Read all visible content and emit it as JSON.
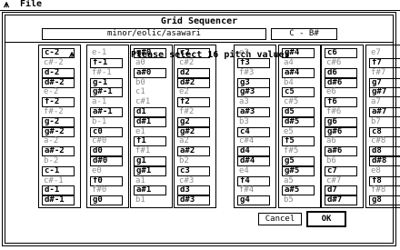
{
  "menubar": {
    "logo": "⩚",
    "file_label": "File"
  },
  "dialog": {
    "title": "Grid Sequencer",
    "scale_field": "minor/eolic/asawari",
    "range_field": "C - B#",
    "note_icon": "⩚",
    "prompt": "Please select 16 pitch values",
    "cancel_label": "Cancel",
    "ok_label": "OK"
  },
  "grid": {
    "columns": [
      {
        "cells": [
          {
            "label": "c-2",
            "selected": true
          },
          {
            "label": "c#-2",
            "selected": false
          },
          {
            "label": "d-2",
            "selected": true
          },
          {
            "label": "d#-2",
            "selected": true
          },
          {
            "label": "e-2",
            "selected": false
          },
          {
            "label": "f-2",
            "selected": true
          },
          {
            "label": "f#-2",
            "selected": false
          },
          {
            "label": "g-2",
            "selected": true
          },
          {
            "label": "g#-2",
            "selected": true
          },
          {
            "label": "a-2",
            "selected": false
          },
          {
            "label": "a#-2",
            "selected": true
          },
          {
            "label": "b-2",
            "selected": false
          },
          {
            "label": "c-1",
            "selected": true
          },
          {
            "label": "c#-1",
            "selected": false
          },
          {
            "label": "d-1",
            "selected": true
          },
          {
            "label": "d#-1",
            "selected": true
          }
        ]
      },
      {
        "cells": [
          {
            "label": "e-1",
            "selected": false
          },
          {
            "label": "f-1",
            "selected": true
          },
          {
            "label": "f#-1",
            "selected": false
          },
          {
            "label": "g-1",
            "selected": true
          },
          {
            "label": "g#-1",
            "selected": true
          },
          {
            "label": "a-1",
            "selected": false
          },
          {
            "label": "a#-1",
            "selected": true
          },
          {
            "label": "b-1",
            "selected": false
          },
          {
            "label": "c0",
            "selected": true
          },
          {
            "label": "c#0",
            "selected": false
          },
          {
            "label": "d0",
            "selected": true
          },
          {
            "label": "d#0",
            "selected": true
          },
          {
            "label": "e0",
            "selected": false
          },
          {
            "label": "f0",
            "selected": true
          },
          {
            "label": "f#0",
            "selected": false
          },
          {
            "label": "g0",
            "selected": true
          }
        ]
      },
      {
        "cells": [
          {
            "label": "g#0",
            "selected": true
          },
          {
            "label": "a0",
            "selected": false
          },
          {
            "label": "a#0",
            "selected": true
          },
          {
            "label": "b0",
            "selected": false
          },
          {
            "label": "c1",
            "selected": false
          },
          {
            "label": "c#1",
            "selected": false
          },
          {
            "label": "d1",
            "selected": true
          },
          {
            "label": "d#1",
            "selected": true
          },
          {
            "label": "e1",
            "selected": false
          },
          {
            "label": "f1",
            "selected": true
          },
          {
            "label": "f#1",
            "selected": false
          },
          {
            "label": "g1",
            "selected": true
          },
          {
            "label": "g#1",
            "selected": true
          },
          {
            "label": "a1",
            "selected": false
          },
          {
            "label": "a#1",
            "selected": true
          },
          {
            "label": "b1",
            "selected": false
          }
        ]
      },
      {
        "cells": [
          {
            "label": "c2",
            "selected": true
          },
          {
            "label": "c#2",
            "selected": false
          },
          {
            "label": "d2",
            "selected": true
          },
          {
            "label": "d#2",
            "selected": true
          },
          {
            "label": "e2",
            "selected": false
          },
          {
            "label": "f2",
            "selected": true
          },
          {
            "label": "f#2",
            "selected": false
          },
          {
            "label": "g2",
            "selected": true
          },
          {
            "label": "g#2",
            "selected": true
          },
          {
            "label": "a2",
            "selected": false
          },
          {
            "label": "a#2",
            "selected": true
          },
          {
            "label": "b2",
            "selected": false
          },
          {
            "label": "c3",
            "selected": true
          },
          {
            "label": "c#3",
            "selected": false
          },
          {
            "label": "d3",
            "selected": true
          },
          {
            "label": "d#3",
            "selected": true
          }
        ]
      },
      {
        "cells": [
          {
            "label": "e3",
            "selected": false
          },
          {
            "label": "f3",
            "selected": true
          },
          {
            "label": "f#3",
            "selected": false
          },
          {
            "label": "g3",
            "selected": true
          },
          {
            "label": "g#3",
            "selected": true
          },
          {
            "label": "a3",
            "selected": false
          },
          {
            "label": "a#3",
            "selected": true
          },
          {
            "label": "b3",
            "selected": false
          },
          {
            "label": "c4",
            "selected": true
          },
          {
            "label": "c#4",
            "selected": false
          },
          {
            "label": "d4",
            "selected": true
          },
          {
            "label": "d#4",
            "selected": true
          },
          {
            "label": "e4",
            "selected": false
          },
          {
            "label": "f4",
            "selected": true
          },
          {
            "label": "f#4",
            "selected": false
          },
          {
            "label": "g4",
            "selected": true
          }
        ]
      },
      {
        "cells": [
          {
            "label": "g#4",
            "selected": true
          },
          {
            "label": "a4",
            "selected": false
          },
          {
            "label": "a#4",
            "selected": true
          },
          {
            "label": "b4",
            "selected": false
          },
          {
            "label": "c5",
            "selected": true
          },
          {
            "label": "c#5",
            "selected": false
          },
          {
            "label": "d5",
            "selected": true
          },
          {
            "label": "d#5",
            "selected": true
          },
          {
            "label": "e5",
            "selected": false
          },
          {
            "label": "f5",
            "selected": true
          },
          {
            "label": "f#5",
            "selected": false
          },
          {
            "label": "g5",
            "selected": true
          },
          {
            "label": "g#5",
            "selected": true
          },
          {
            "label": "a5",
            "selected": false
          },
          {
            "label": "a#5",
            "selected": true
          },
          {
            "label": "b5",
            "selected": false
          }
        ]
      },
      {
        "cells": [
          {
            "label": "c6",
            "selected": true
          },
          {
            "label": "c#6",
            "selected": false
          },
          {
            "label": "d6",
            "selected": true
          },
          {
            "label": "d#6",
            "selected": true
          },
          {
            "label": "e6",
            "selected": false
          },
          {
            "label": "f6",
            "selected": true
          },
          {
            "label": "f#6",
            "selected": false
          },
          {
            "label": "g6",
            "selected": true
          },
          {
            "label": "g#6",
            "selected": true
          },
          {
            "label": "a6",
            "selected": false
          },
          {
            "label": "a#6",
            "selected": true
          },
          {
            "label": "b6",
            "selected": false
          },
          {
            "label": "c7",
            "selected": true
          },
          {
            "label": "c#7",
            "selected": false
          },
          {
            "label": "d7",
            "selected": true
          },
          {
            "label": "d#7",
            "selected": true
          }
        ]
      },
      {
        "cells": [
          {
            "label": "e7",
            "selected": false
          },
          {
            "label": "f7",
            "selected": true
          },
          {
            "label": "f#7",
            "selected": false
          },
          {
            "label": "g7",
            "selected": true
          },
          {
            "label": "g#7",
            "selected": true
          },
          {
            "label": "a7",
            "selected": false
          },
          {
            "label": "a#7",
            "selected": true
          },
          {
            "label": "b7",
            "selected": false
          },
          {
            "label": "c8",
            "selected": true
          },
          {
            "label": "c#8",
            "selected": false
          },
          {
            "label": "d8",
            "selected": true
          },
          {
            "label": "d#8",
            "selected": true
          },
          {
            "label": "e8",
            "selected": false
          },
          {
            "label": "f8",
            "selected": true
          },
          {
            "label": "f#8",
            "selected": false
          },
          {
            "label": "g8",
            "selected": true
          }
        ]
      }
    ]
  }
}
